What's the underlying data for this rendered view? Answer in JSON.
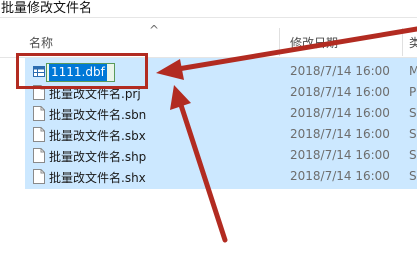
{
  "window": {
    "title": "批量修改文件名"
  },
  "header": {
    "name": "名称",
    "sort_indicator": "^",
    "date": "修改日期",
    "type": "类"
  },
  "files": [
    {
      "name": "1111.dbf",
      "date": "2018/7/14 16:00",
      "type": "M",
      "icon": "table-file-icon"
    },
    {
      "name": "批量改文件名.prj",
      "date": "2018/7/14 16:00",
      "type": "P",
      "icon": "document-icon"
    },
    {
      "name": "批量改文件名.sbn",
      "date": "2018/7/14 16:00",
      "type": "S",
      "icon": "document-icon"
    },
    {
      "name": "批量改文件名.sbx",
      "date": "2018/7/14 16:00",
      "type": "S",
      "icon": "document-icon"
    },
    {
      "name": "批量改文件名.shp",
      "date": "2018/7/14 16:00",
      "type": "S",
      "icon": "document-icon"
    },
    {
      "name": "批量改文件名.shx",
      "date": "2018/7/14 16:00",
      "type": "S",
      "icon": "document-icon"
    }
  ],
  "colors": {
    "selection": "#cce8ff",
    "annotation": "#b22b21",
    "rename_highlight": "#0078d7"
  }
}
